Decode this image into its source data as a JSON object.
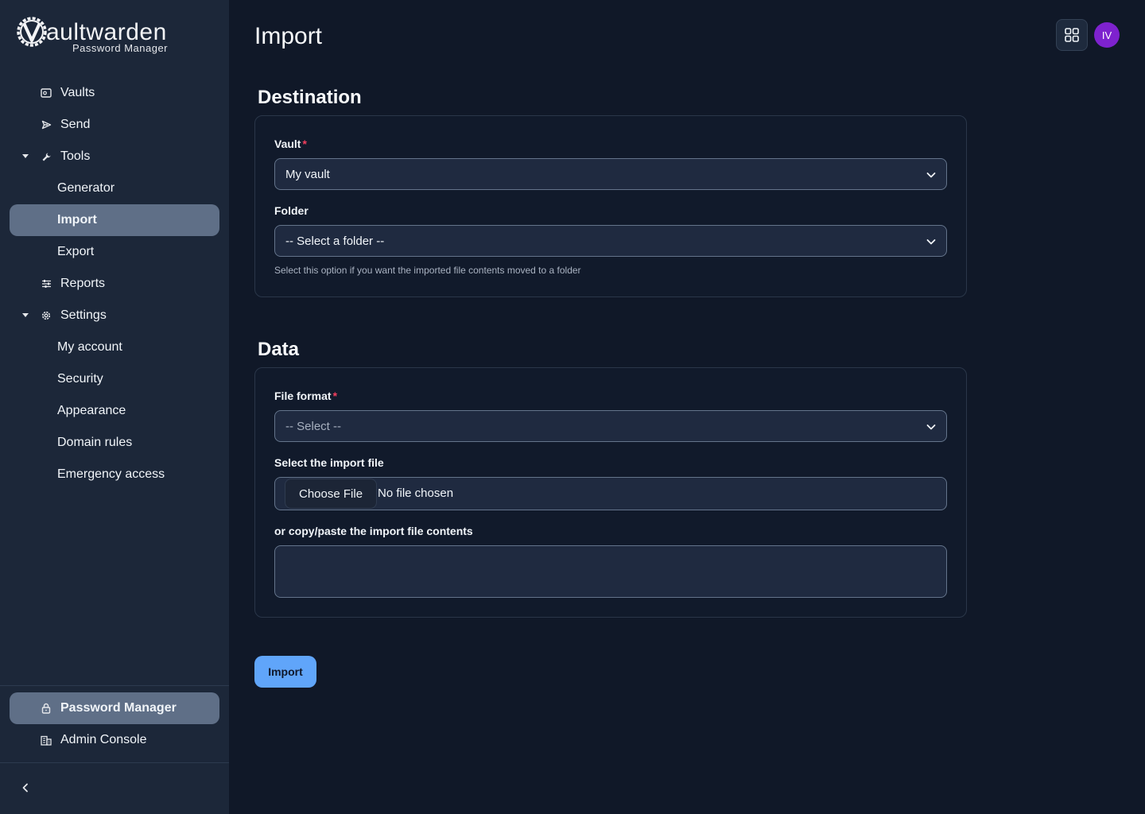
{
  "app": {
    "logo_title": "aultwarden",
    "logo_subtitle": "Password Manager"
  },
  "sidebar": {
    "items": [
      {
        "label": "Vaults",
        "icon": "vault-icon"
      },
      {
        "label": "Send",
        "icon": "send-icon"
      },
      {
        "label": "Tools",
        "icon": "wrench-icon",
        "expanded": true
      },
      {
        "label": "Generator"
      },
      {
        "label": "Import",
        "active": true
      },
      {
        "label": "Export"
      },
      {
        "label": "Reports",
        "icon": "sliders-icon"
      },
      {
        "label": "Settings",
        "icon": "gear-icon",
        "expanded": true
      },
      {
        "label": "My account"
      },
      {
        "label": "Security"
      },
      {
        "label": "Appearance"
      },
      {
        "label": "Domain rules"
      },
      {
        "label": "Emergency access"
      }
    ],
    "products": [
      {
        "label": "Password Manager",
        "icon": "lock-icon",
        "active": true
      },
      {
        "label": "Admin Console",
        "icon": "building-icon"
      }
    ]
  },
  "header": {
    "title": "Import",
    "avatar_initials": "IV"
  },
  "destination": {
    "title": "Destination",
    "vault_label": "Vault",
    "vault_value": "My vault",
    "folder_label": "Folder",
    "folder_value": "-- Select a folder --",
    "folder_hint": "Select this option if you want the imported file contents moved to a folder"
  },
  "data_section": {
    "title": "Data",
    "format_label": "File format",
    "format_placeholder": "-- Select --",
    "file_label": "Select the import file",
    "choose_file": "Choose File",
    "no_file": "No file chosen",
    "paste_label": "or copy/paste the import file contents",
    "paste_value": ""
  },
  "actions": {
    "import_label": "Import"
  },
  "colors": {
    "background": "#101828",
    "sidebar": "#1c2739",
    "active_item": "#5f6f87",
    "primary_button": "#60a5fa",
    "avatar": "#7e22ce",
    "required": "#f43f5e"
  }
}
